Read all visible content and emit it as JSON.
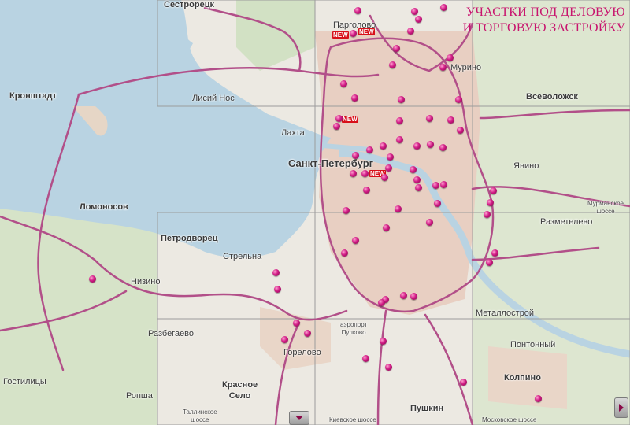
{
  "title": [
    "УЧАСТКИ ПОД ДЕЛОВУЮ",
    "И ТОРГОВУЮ ЗАСТРОЙКУ"
  ],
  "new_label": "NEW",
  "colors": {
    "water": "#b9d3e2",
    "land": "#ece9e2",
    "forest": "#cfdfc0",
    "city": "#e6cfc0",
    "road": "#b24f89",
    "grid": "#9c9c9c",
    "pin": "#d01a84",
    "title": "#c8146e"
  },
  "places": {
    "sestroretsk": "Сестрорецк",
    "pargolovo": "Парголово",
    "murino": "Мурино",
    "kronshtadt": "Кронштадт",
    "lisiy_nos": "Лисий Нос",
    "vsevolozhsk": "Всеволожск",
    "lakhta": "Лахта",
    "spb": "Санкт-Петербург",
    "yanino": "Янино",
    "lomonosov": "Ломоносов",
    "murmanskoe": [
      "Мурманское",
      "шоссе"
    ],
    "razmetelevo": "Разметелево",
    "petrodvorets": "Петродворец",
    "strelna": "Стрельна",
    "nizino": "Низино",
    "metallostroy": "Металлострой",
    "airport": [
      "аэропорт",
      "Пулково"
    ],
    "razbegaevo": "Разбегаево",
    "gorelovo": "Горелово",
    "pontonny": "Понтонный",
    "gostilitsy": "Гостилицы",
    "krasnoe_selo": [
      "Красное",
      "Село"
    ],
    "kolpino": "Колпино",
    "ropsha": "Ропша",
    "pushkin": "Пушкин",
    "tallinskoe": [
      "Таллинское",
      "шоссе"
    ],
    "kievskoe": "Киевскоe шоссе",
    "moskovskoe": "Московское шоссе"
  },
  "plots": 64,
  "new_plots": 4
}
